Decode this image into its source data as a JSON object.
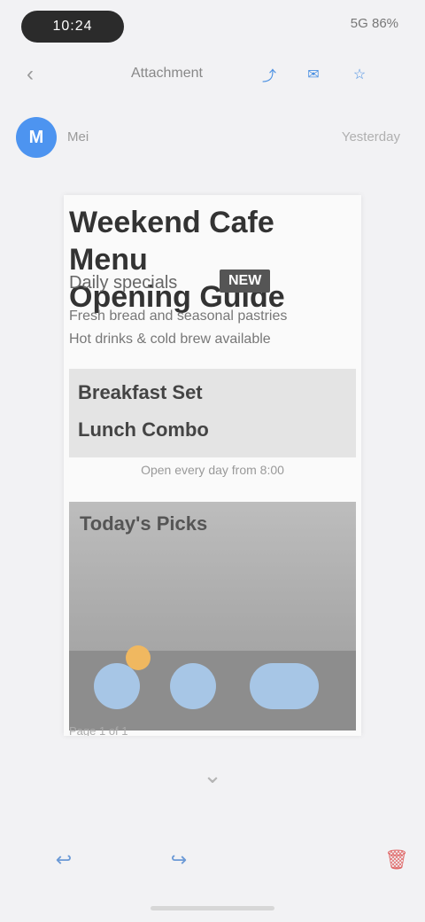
{
  "status_bar": {
    "pill_text": "10:24",
    "right_text": "5G 86%"
  },
  "toolbar": {
    "back_icon": "chevron-left-icon",
    "title": "Attachment",
    "icons": [
      "share-icon",
      "mail-icon",
      "star-icon"
    ]
  },
  "sender": {
    "initial": "M",
    "name": "Mei",
    "time": "Yesterday"
  },
  "attachment": {
    "title_line1": "Weekend Cafe Menu",
    "title_line2": "Opening Guide",
    "subtitle": "Daily specials",
    "badge": "NEW",
    "line1": "Fresh bread and seasonal pastries",
    "line2": "Hot drinks & cold brew available",
    "block_line1": "Breakfast Set",
    "block_line2": "Lunch Combo",
    "caption": "Open every day from 8:00",
    "photo_label": "Today's Picks",
    "footer": "Page 1 of 1"
  },
  "controls": {
    "scroll_icon": "chevron-down-icon",
    "reply_icon": "reply-icon",
    "forward_icon": "forward-icon",
    "delete_icon": "trash-icon"
  },
  "colors": {
    "accent": "#4d94f0",
    "danger": "#e06b6b"
  }
}
